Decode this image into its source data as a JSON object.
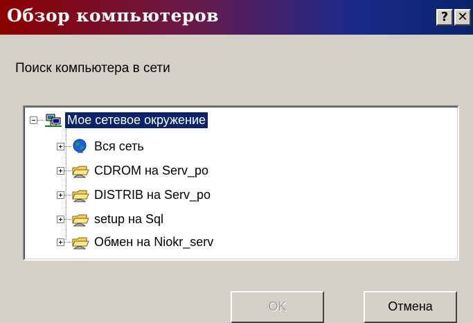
{
  "window": {
    "title": "Обзор компьютеров",
    "help_label": "?",
    "close_label": "✕",
    "title_gradient": [
      "#8b0000",
      "#0a246a"
    ]
  },
  "caption": "Поиск компьютера в сети",
  "tree": {
    "root": {
      "label": "Мое сетевое окружение",
      "icon": "network-neighborhood-icon",
      "selected": true,
      "expanded": true
    },
    "items": [
      {
        "label": "Вся сеть",
        "icon": "globe-icon"
      },
      {
        "label": "CDROM на Serv_po",
        "icon": "shared-folder-icon"
      },
      {
        "label": "DISTRIB на Serv_po",
        "icon": "shared-folder-icon"
      },
      {
        "label": "setup на Sql",
        "icon": "shared-folder-icon"
      },
      {
        "label": "Обмен на Niokr_serv",
        "icon": "shared-folder-icon"
      }
    ]
  },
  "buttons": {
    "ok": {
      "label": "OK",
      "enabled": false
    },
    "cancel": {
      "label": "Отмена",
      "enabled": true
    }
  },
  "colors": {
    "selection": "#0a246a",
    "face": "#d4d0c8"
  }
}
